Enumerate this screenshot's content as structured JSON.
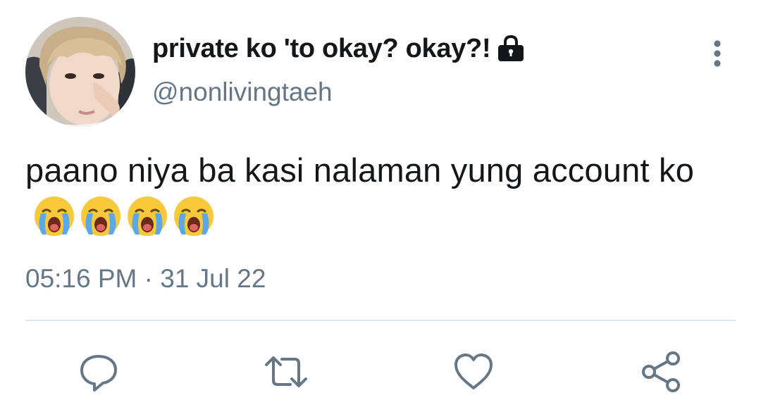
{
  "user": {
    "display_name": "private ko 'to okay? okay?!",
    "handle": "@nonlivingtaeh",
    "protected_icon": "lock-icon",
    "avatar": "profile-photo"
  },
  "tweet": {
    "text": "paano niya ba kasi nalaman yung account ko",
    "emojis": [
      "loudly-crying-face",
      "loudly-crying-face",
      "loudly-crying-face",
      "loudly-crying-face"
    ],
    "timestamp": "05:16 PM · 31 Jul 22"
  },
  "actions": [
    {
      "name": "reply",
      "icon": "reply-icon"
    },
    {
      "name": "retweet",
      "icon": "retweet-icon"
    },
    {
      "name": "like",
      "icon": "heart-icon"
    },
    {
      "name": "share",
      "icon": "share-icon"
    }
  ],
  "menu": {
    "icon": "more-vertical-icon"
  },
  "colors": {
    "text_primary": "#14171a",
    "text_secondary": "#657786",
    "divider": "#e1e8ed",
    "icon": "#657786",
    "emoji_face": "#f9c93c",
    "emoji_tears": "#5aa9e6"
  }
}
